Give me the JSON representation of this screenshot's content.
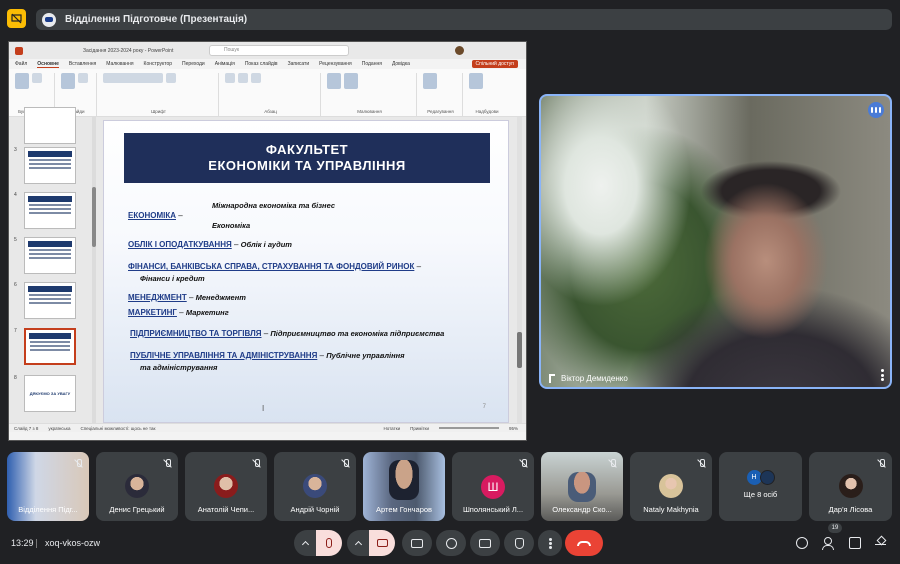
{
  "meeting": {
    "title": "Відділення Підготовче (Презентація)",
    "time": "13:29",
    "code": "xoq-vkos-ozw",
    "participant_count": "19"
  },
  "powerpoint": {
    "file": "Засідання 2023-2024 року - PowerPoint",
    "search_placeholder": "Пошук",
    "share_label": "Спільний доступ",
    "menu": [
      "Файл",
      "Основне",
      "Вставлення",
      "Малювання",
      "Конструктор",
      "Переходи",
      "Анімація",
      "Показ слайдів",
      "Записати",
      "Рецензування",
      "Подання",
      "Довідка"
    ],
    "ribbon_groups": [
      "Буфер обміну",
      "Слайди",
      "Шрифт",
      "Абзац",
      "Малювання",
      "Редагування",
      "Надбудови"
    ],
    "thumb_numbers": [
      "3",
      "4",
      "5",
      "6",
      "7",
      "8"
    ],
    "last_thumb_text": "ДЯКУЄМО ЗА УВАГУ",
    "status": {
      "slide": "Слайд 7 з 8",
      "language": "українська",
      "accessibility": "Спеціальні можливості: щось не так",
      "notes": "Нотатки",
      "comments": "Примітки",
      "zoom": "95%"
    }
  },
  "slide": {
    "title_line1": "ФАКУЛЬТЕТ",
    "title_line2": "ЕКОНОМІКИ ТА УПРАВЛІННЯ",
    "page_number": "7",
    "rows": [
      {
        "dept": "ЕКОНОМІКА",
        "sep": " –",
        "program": ""
      },
      {
        "dept": "",
        "sep": "",
        "program": "Міжнародна економіка та бізнес"
      },
      {
        "dept": "",
        "sep": "",
        "program": "Економіка"
      },
      {
        "dept": "ОБЛІК І ОПОДАТКУВАННЯ",
        "sep": " – ",
        "program": "Облік і аудит"
      },
      {
        "dept": "ФІНАНСИ, БАНКІВСЬКА СПРАВА, СТРАХУВАННЯ ТА ФОНДОВИЙ РИНОК",
        "sep": " –",
        "program": ""
      },
      {
        "dept": "",
        "sep": "",
        "program": "Фінанси і кредит"
      },
      {
        "dept": "МЕНЕДЖМЕНТ",
        "sep": " – ",
        "program": "Менеджмент"
      },
      {
        "dept": "МАРКЕТИНГ",
        "sep": " – ",
        "program": "Маркетинг"
      },
      {
        "dept": "ПІДПРИЄМНИЦТВО ТА ТОРГІВЛЯ",
        "sep": "  – ",
        "program": "Підприємництво та економіка підприємства"
      },
      {
        "dept": "ПУБЛІЧНЕ УПРАВЛІННЯ ТА АДМІНІСТРУВАННЯ",
        "sep": " – ",
        "program": "Публічне управління"
      },
      {
        "dept": "",
        "sep": "",
        "program": "та адміністрування"
      }
    ]
  },
  "speaker": {
    "name": "Віктор Демиденко"
  },
  "participants": [
    {
      "name": "Відділення Підг..."
    },
    {
      "name": "Денис Грецький"
    },
    {
      "name": "Анатолій Чепи..."
    },
    {
      "name": "Андрій Чорній"
    },
    {
      "name": "Артем Гончаров"
    },
    {
      "name": "Шполянський Л...",
      "initial": "Ш"
    },
    {
      "name": "Олександр Ско..."
    },
    {
      "name": "Nataly Makhynia"
    },
    {
      "name": "Ще 8 осіб",
      "initial": "Н"
    },
    {
      "name": "Дар'я Лісова"
    }
  ],
  "colors": {
    "background": "#202124",
    "accent_yellow": "#fbbc04",
    "speaker_border": "#8ab4f8",
    "hangup": "#ea4335",
    "slide_header": "#1f2f5a",
    "ppt_accent": "#c43e1c"
  }
}
